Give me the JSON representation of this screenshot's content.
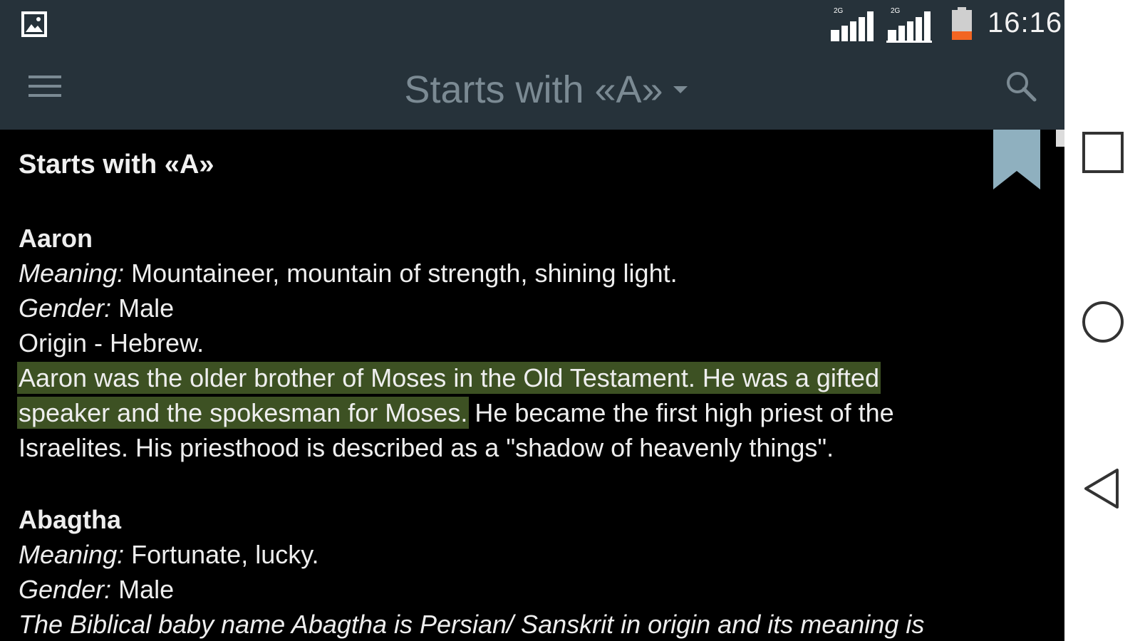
{
  "statusbar": {
    "time": "16:16",
    "network_1": "2G",
    "network_2": "2G",
    "battery_color": "#f26522"
  },
  "toolbar": {
    "title": "Starts with «A»",
    "menu_icon": "hamburger-menu-icon",
    "search_icon": "search-icon",
    "dropdown_icon": "caret-down-icon"
  },
  "content": {
    "section_title": "Starts with «A»",
    "entries": [
      {
        "name": "Aaron",
        "meaning_label": "Meaning:",
        "meaning_value": " Mountaineer, mountain of strength, shining light.",
        "gender_label": "Gender:",
        "gender_value": " Male",
        "origin": "Origin - Hebrew.",
        "desc_line1_highlighted": "Aaron was the older brother of Moses in the Old Testament. He was a gifted",
        "desc_line2_highlighted": "speaker and the spokesman for Moses.",
        "desc_line2_rest": " He became the first high priest of the",
        "desc_line3": "Israelites. His priesthood is described as a \"shadow of heavenly things\"."
      },
      {
        "name": "Abagtha",
        "meaning_label": "Meaning:",
        "meaning_value": " Fortunate, lucky.",
        "gender_label": "Gender:",
        "gender_value": " Male",
        "desc_line1": "The Biblical baby name Abagtha is Persian/ Sanskrit in origin and its meaning is"
      }
    ]
  },
  "colors": {
    "bar_background": "#26323a",
    "highlight": "#3d5123",
    "title_color": "#7b8a93",
    "bookmark_color": "#8fb0bf"
  },
  "navigation": {
    "recents_icon": "recents-square-icon",
    "home_icon": "home-circle-icon",
    "back_icon": "back-triangle-icon"
  }
}
